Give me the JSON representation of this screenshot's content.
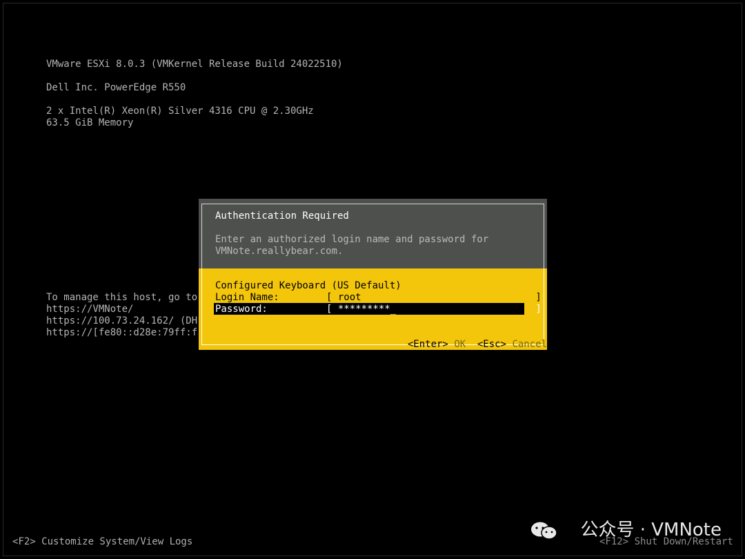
{
  "system": {
    "version": "VMware ESXi 8.0.3 (VMKernel Release Build 24022510)",
    "hardware": "Dell Inc. PowerEdge R550",
    "cpu": "2 x Intel(R) Xeon(R) Silver 4316 CPU @ 2.30GHz",
    "memory": "63.5 GiB Memory"
  },
  "manage": {
    "line1": "To manage this host, go to",
    "line2": "https://VMNote/",
    "line3": "https://100.73.24.162/ (DH",
    "line4": "https://[fe80::d28e:79ff:f"
  },
  "dialog": {
    "title": "Authentication Required",
    "message_line1": "Enter an authorized login name and password for",
    "message_line2": "VMNote.reallybear.com.",
    "keyboard": "Configured Keyboard (US Default)",
    "login_label": "Login Name:",
    "login_value": "[ root                              ]",
    "password_label": "Password:",
    "password_value": "[ *********_                        ]",
    "enter_key": "<Enter>",
    "ok": "OK",
    "esc_key": "<Esc>",
    "cancel": "Cancel"
  },
  "footer": {
    "left": "<F2> Customize System/View Logs",
    "right": "<F12> Shut Down/Restart"
  },
  "watermark": {
    "text": "公众号 · VMNote",
    "icon": "wechat-icon"
  },
  "colors": {
    "background": "#000000",
    "dialog_header": "#4d504d",
    "dialog_body": "#f3c60b",
    "text": "#b8b8b8"
  }
}
